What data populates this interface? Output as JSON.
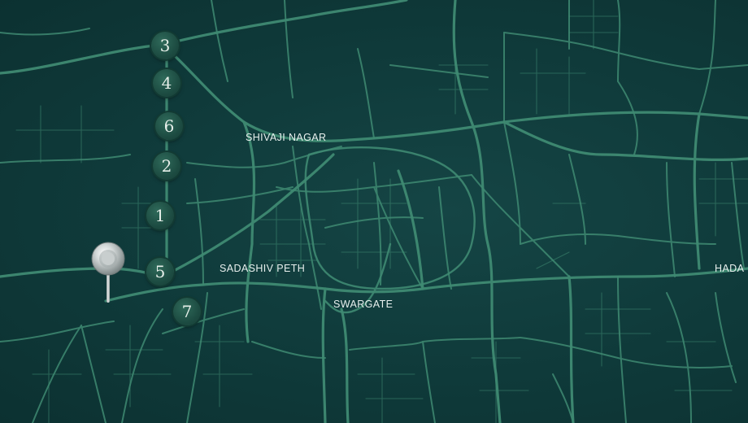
{
  "map": {
    "labels": {
      "shivaji_nagar": "SHIVAJI NAGAR",
      "sadashiv_peth": "SADASHIV PETH",
      "swargate": "SWARGATE",
      "hada": "HADA"
    },
    "markers": [
      "3",
      "4",
      "6",
      "2",
      "1",
      "5",
      "7"
    ],
    "colors": {
      "background": "#0f3b3b",
      "road": "#3f8a72",
      "marker": "#1d4c42",
      "pin": "#c9cfcf"
    },
    "location_pin_icon": "map-pin-icon"
  }
}
